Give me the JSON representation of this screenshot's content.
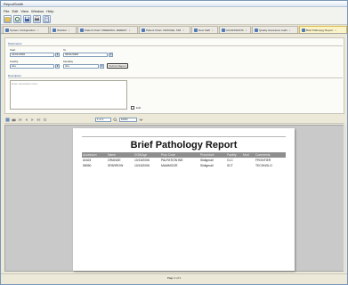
{
  "window": {
    "title": "ReportSmith"
  },
  "menu": [
    "File",
    "Edit",
    "View",
    "Window",
    "Help"
  ],
  "toolbar": {
    "icons": [
      "open-icon",
      "refresh-icon",
      "save-icon",
      "print-icon",
      "report-icon"
    ]
  },
  "tabs": [
    {
      "label": "System Configuration",
      "active": false
    },
    {
      "label": "Worklist",
      "active": false
    },
    {
      "label": "Patient Chart: FREEMAN, JEREMY",
      "active": false
    },
    {
      "label": "Patient Chart: ORANGE, KIM",
      "active": false
    },
    {
      "label": "New Staff",
      "active": false
    },
    {
      "label": "ACCESSIONS",
      "active": false
    },
    {
      "label": "Quality Assurance Audit",
      "active": false
    },
    {
      "label": "Brief Pathology Report",
      "active": true
    }
  ],
  "params": {
    "group_label": "Parameters",
    "start_label": "Start",
    "start_value": "01/01/2006",
    "to_label": "To",
    "to_value": "06/01/2006",
    "facility_label": "Facility",
    "facility_value": "ALL",
    "modality_label": "Modality",
    "modality_value": "ALL",
    "submit_label": "Submit Report",
    "description_label": "Description",
    "description_placeholder": "Enter description here",
    "checkbox_label": "Edit"
  },
  "viewer": {
    "page_label": "1 of 1",
    "zoom_value": "100%"
  },
  "report": {
    "title": "Brief Pathology Report",
    "columns": [
      "Accession",
      "Name",
      "DOB/Age",
      "Proc Code",
      "Procedure",
      "Facility",
      "Mod",
      "Comments"
    ],
    "rows": [
      [
        "#1624",
        "ORANGE",
        "10/15/2006",
        "PALPATION BIE",
        "Slidigmall",
        "CLC",
        "FRONTIER"
      ],
      [
        "58050",
        "SPARROW",
        "10/15/2006",
        "MAMMOGR",
        "Slidigmall",
        "SCT",
        "TECHNOLO"
      ]
    ]
  },
  "status": {
    "page_text": "Page 1 of 1"
  }
}
